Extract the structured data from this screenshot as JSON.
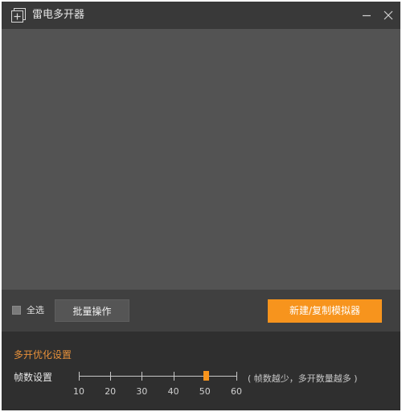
{
  "window": {
    "title": "雷电多开器",
    "app_icon": "app-icon",
    "minimize_icon": "minimize-icon",
    "close_icon": "close-icon"
  },
  "list": {
    "items": []
  },
  "actions": {
    "select_all_label": "全选",
    "select_all_checked": false,
    "batch_label": "批量操作",
    "new_label": "新建/复制模拟器"
  },
  "optimization": {
    "title": "多开优化设置",
    "fps_label": "帧数设置",
    "fps_ticks": [
      "10",
      "20",
      "30",
      "40",
      "50",
      "60"
    ],
    "fps_min": 10,
    "fps_max": 60,
    "fps_value": 50,
    "fps_hint": "( 帧数越少，多开数量越多 )"
  },
  "colors": {
    "accent": "#f7941d",
    "section_title": "#e7903a",
    "window_bg": "#3b3b3b",
    "list_bg": "#535353"
  }
}
